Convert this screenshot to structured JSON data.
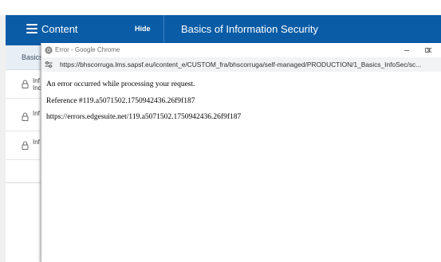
{
  "header": {
    "menu_label": "Content",
    "hide_label": "Hide",
    "course_title": "Basics of Information Security"
  },
  "sidebar": {
    "breadcrumb": "Basics",
    "items": [
      {
        "label": "Inf Inc"
      },
      {
        "label": "Inf"
      },
      {
        "label": "Inf"
      }
    ]
  },
  "popup": {
    "title": "Error - Google Chrome",
    "url": "https://bhscorruga.lms.sapsf.eu/icontent_e/CUSTOM_fra/bhscorruga/self-managed/PRODUCTION/1_Basics_InfoSec/sc...",
    "body": {
      "error_message": "An error occurred while processing your request.",
      "reference": "Reference #119.a5071502.1750942436.26f9f187",
      "error_url": "https://errors.edgesuite.net/119.a5071502.1750942436.26f9f187"
    }
  },
  "colors": {
    "header_bg": "#0a5ca6",
    "breadcrumb_bg": "#e8eef6",
    "address_bar_bg": "#f1f3f4"
  }
}
